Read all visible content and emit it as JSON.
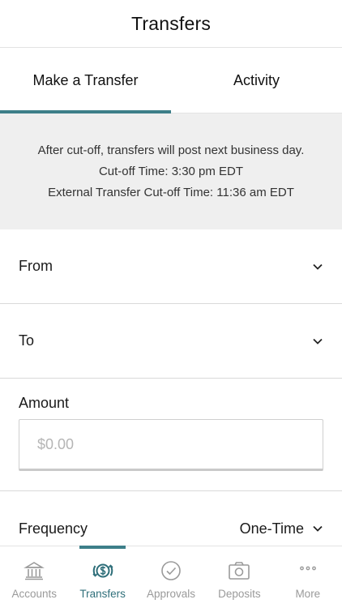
{
  "header": {
    "title": "Transfers"
  },
  "tabs": [
    {
      "label": "Make a Transfer",
      "active": true
    },
    {
      "label": "Activity",
      "active": false
    }
  ],
  "notice": {
    "line1": "After cut-off, transfers will post next business day.",
    "line2": "Cut-off Time: 3:30 pm EDT",
    "line3": "External Transfer Cut-off Time: 11:36 am EDT"
  },
  "form": {
    "from_label": "From",
    "to_label": "To",
    "amount_label": "Amount",
    "amount_placeholder": "$0.00",
    "frequency_label": "Frequency",
    "frequency_value": "One-Time"
  },
  "bottom_nav": [
    {
      "label": "Accounts",
      "icon": "bank-icon",
      "active": false
    },
    {
      "label": "Transfers",
      "icon": "transfer-dollar-icon",
      "active": true
    },
    {
      "label": "Approvals",
      "icon": "check-circle-icon",
      "active": false
    },
    {
      "label": "Deposits",
      "icon": "camera-icon",
      "active": false
    },
    {
      "label": "More",
      "icon": "more-dots-icon",
      "active": false
    }
  ],
  "colors": {
    "accent": "#3d7f89",
    "notice_bg": "#efefef",
    "inactive_nav": "#9a9a9a"
  }
}
